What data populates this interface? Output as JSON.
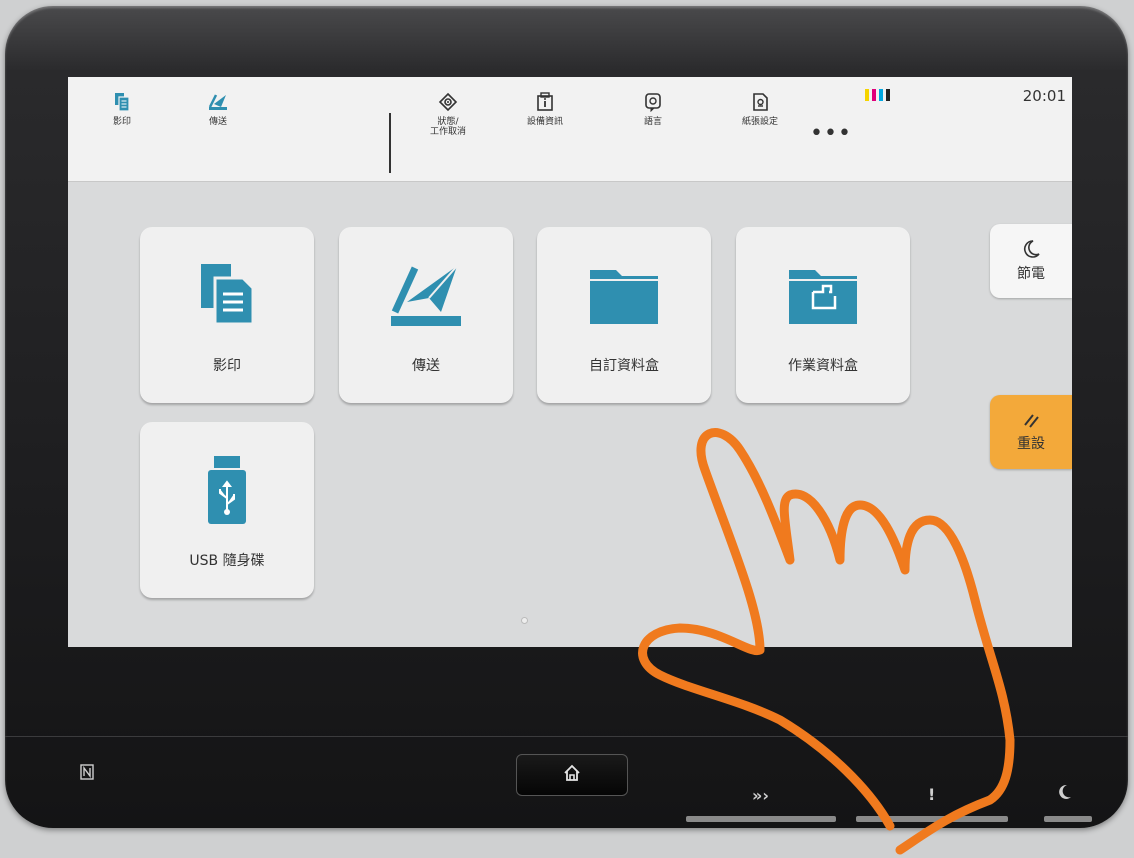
{
  "topbar": {
    "buttons": [
      {
        "label": "影印",
        "icon": "copy-icon"
      },
      {
        "label": "傳送",
        "icon": "send-icon"
      },
      {
        "label": "狀態/\n工作取消",
        "icon": "status-eye-icon"
      },
      {
        "label": "設備資訊",
        "icon": "device-info-icon"
      },
      {
        "label": "語言",
        "icon": "language-icon"
      },
      {
        "label": "紙張設定",
        "icon": "paper-settings-icon"
      }
    ],
    "more": "•••",
    "clock": "20:01",
    "toner_colors": [
      "#f5d400",
      "#e0007a",
      "#00a7e1",
      "#222222"
    ]
  },
  "tiles": [
    {
      "label": "影印",
      "icon": "copy-icon"
    },
    {
      "label": "傳送",
      "icon": "send-icon"
    },
    {
      "label": "自訂資料盒",
      "icon": "folder-icon"
    },
    {
      "label": "作業資料盒",
      "icon": "job-box-folder-icon"
    },
    {
      "label": "USB 隨身碟",
      "icon": "usb-drive-icon"
    }
  ],
  "side": {
    "power_save": "節電",
    "reset": "重設"
  },
  "hardware": {
    "nfc_icon": "nfc-icon",
    "home_icon": "home-icon",
    "processing_icon": "processing-icon",
    "attention": "!",
    "sleep_icon": "moon-icon"
  },
  "colors": {
    "accent_teal": "#2f8fb0",
    "reset_orange": "#f3a93a",
    "hand_overlay": "#f07a1e"
  }
}
